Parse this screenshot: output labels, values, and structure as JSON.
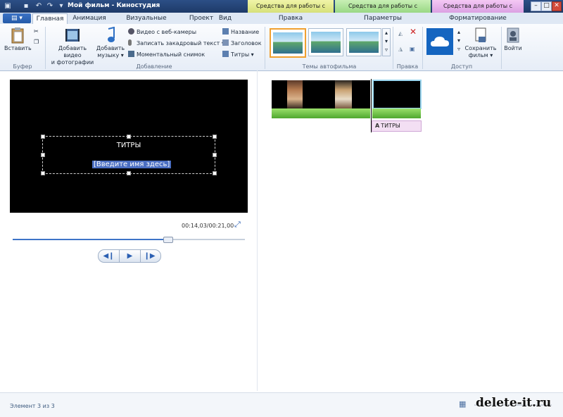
{
  "window": {
    "title": "Мой фильм - Киностудия",
    "minimize": "–",
    "maximize": "□",
    "close": "✕"
  },
  "quick_access": [
    "save-icon",
    "undo-icon",
    "redo-icon",
    "dropdown-icon"
  ],
  "contextual_tabs": {
    "video": "Средства для работы с видео",
    "music": "Средства для работы с музыкой",
    "text": "Средства для работы с текстом"
  },
  "tabs": {
    "file": "▤ ▾",
    "home": "Главная",
    "animation": "Анимация",
    "visual_effects": "Визуальные эффекты",
    "project": "Проект",
    "view": "Вид",
    "edit": "Правка",
    "options": "Параметры",
    "format": "Форматирование"
  },
  "ribbon": {
    "clipboard": {
      "paste": "Вставить",
      "group": "Буфер"
    },
    "add": {
      "add_video_line1": "Добавить видео",
      "add_video_line2": "и фотографии",
      "add_music_line1": "Добавить",
      "add_music_line2": "музыку ▾",
      "webcam": "Видео с веб-камеры",
      "narration": "Записать закадровый текст ▾",
      "snapshot": "Моментальный снимок",
      "title": "Название",
      "caption": "Заголовок",
      "credits": "Титры ▾",
      "group": "Добавление"
    },
    "themes": {
      "group": "Темы автофильма"
    },
    "edit_group": "Правка",
    "access": {
      "save_line1": "Сохранить",
      "save_line2": "фильм ▾",
      "group": "Доступ"
    },
    "signin": "Войти"
  },
  "preview": {
    "title_text": "ТИТРЫ",
    "name_placeholder": "[Введите имя здесь]",
    "timecode": "00:14,03/00:21,00",
    "progress": 0.668
  },
  "storyboard": {
    "text_clip_label": "ТИТРЫ"
  },
  "status": {
    "item_text": "Элемент 3 из 3"
  },
  "watermark": "delete-it.ru",
  "colors": {
    "accent": "#3e74c8",
    "video_tab": "#d6e079",
    "music_tab": "#99d884",
    "text_tab": "#dba1e3"
  }
}
